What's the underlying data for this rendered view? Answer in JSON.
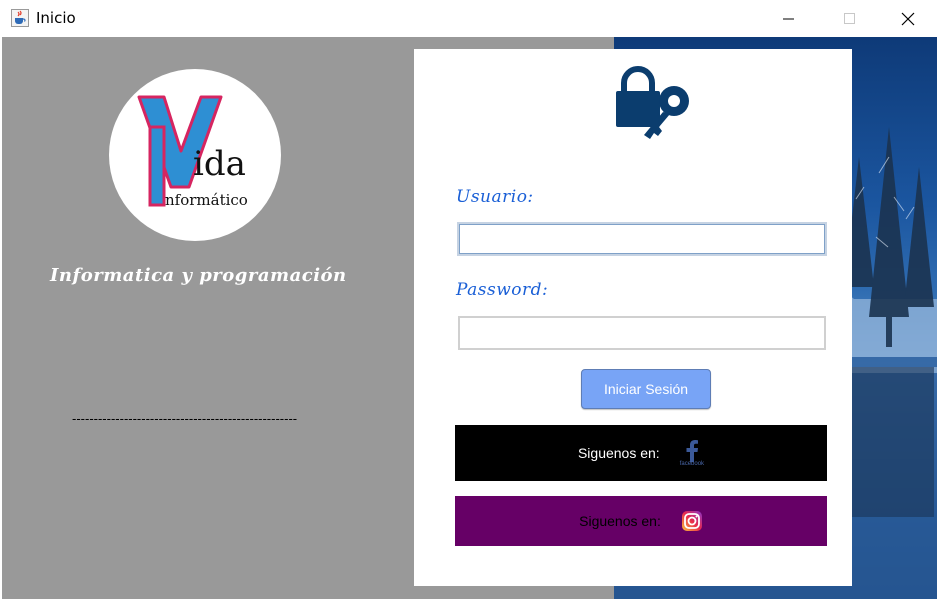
{
  "window": {
    "title": "Inicio",
    "icon": "java-cup-icon",
    "controls": {
      "minimize": "minimize-icon",
      "maximize": "maximize-icon",
      "close": "close-icon"
    }
  },
  "branding": {
    "logo_big_letters": "V",
    "logo_word_1": "ida",
    "logo_word_2": "nformático",
    "logo_letter_2": "I",
    "tagline": "Informatica y programación",
    "separator": "----------------------------------------------------"
  },
  "login": {
    "lock_icon": "lock-key-icon",
    "username_label": "Usuario:",
    "username_value": "",
    "password_label": "Password:",
    "password_value": "",
    "submit_label": "Iniciar Sesión"
  },
  "social": [
    {
      "text": "Siguenos en:",
      "icon": "facebook-icon",
      "icon_caption": "facebook"
    },
    {
      "text": "Siguenos en:",
      "icon": "instagram-icon"
    }
  ],
  "colors": {
    "left_panel": "#999999",
    "label_blue": "#1a5fd6",
    "button": "#78a4f6",
    "facebook_bar": "#000000",
    "instagram_bar": "#660066"
  }
}
